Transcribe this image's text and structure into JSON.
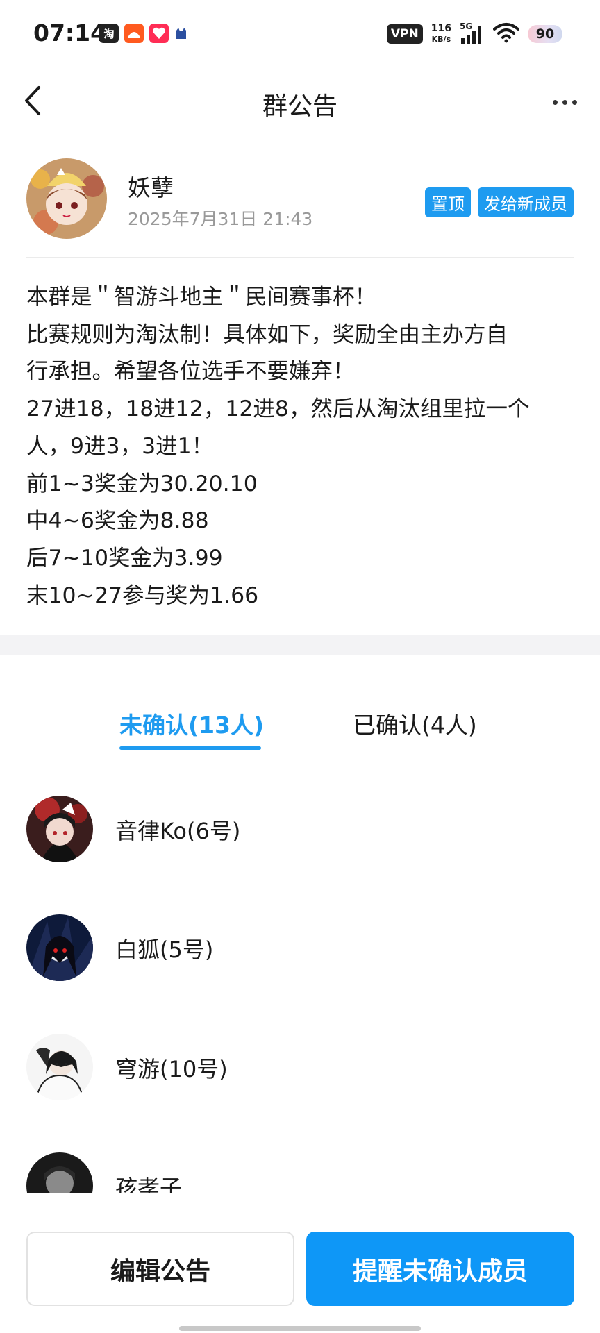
{
  "status_bar": {
    "time": "07:14",
    "app_icons": [
      "taobao-icon",
      "orange-app-icon",
      "red-app-icon",
      "cat-app-icon"
    ],
    "vpn": "VPN",
    "net_speed_value": "116",
    "net_speed_unit": "KB/s",
    "network": "5G",
    "battery": "90"
  },
  "header": {
    "title": "群公告",
    "back_icon": "chevron-left-icon",
    "more_icon": "more-horizontal-icon"
  },
  "author": {
    "name": "妖孽",
    "timestamp": "2025年7月31日 21:43",
    "tags": [
      "置顶",
      "发给新成员"
    ]
  },
  "notice_lines": [
    "本群是＂智游斗地主＂民间赛事杯！",
    "比赛规则为淘汰制！具体如下，奖励全由主办方自",
    "行承担。希望各位选手不要嫌弃！",
    "27进18，18进12，12进8，然后从淘汰组里拉一个",
    "人，9进3，3进1！",
    "前1~3奖金为30.20.10",
    "中4~6奖金为8.88",
    "后7~10奖金为3.99",
    "末10~27参与奖为1.66"
  ],
  "tabs": [
    {
      "label": "未确认(13人)",
      "active": true
    },
    {
      "label": "已确认(4人)",
      "active": false
    }
  ],
  "members": [
    {
      "name": "音律Ko(6号)"
    },
    {
      "name": "白狐(5号)"
    },
    {
      "name": "穹游(10号)"
    },
    {
      "name": "孩孝子"
    }
  ],
  "buttons": {
    "edit": "编辑公告",
    "remind": "提醒未确认成员"
  },
  "colors": {
    "accent": "#1e9bf0",
    "primary_button": "#0e97f7",
    "secondary_text": "#999999",
    "section_band": "#f3f3f5"
  }
}
